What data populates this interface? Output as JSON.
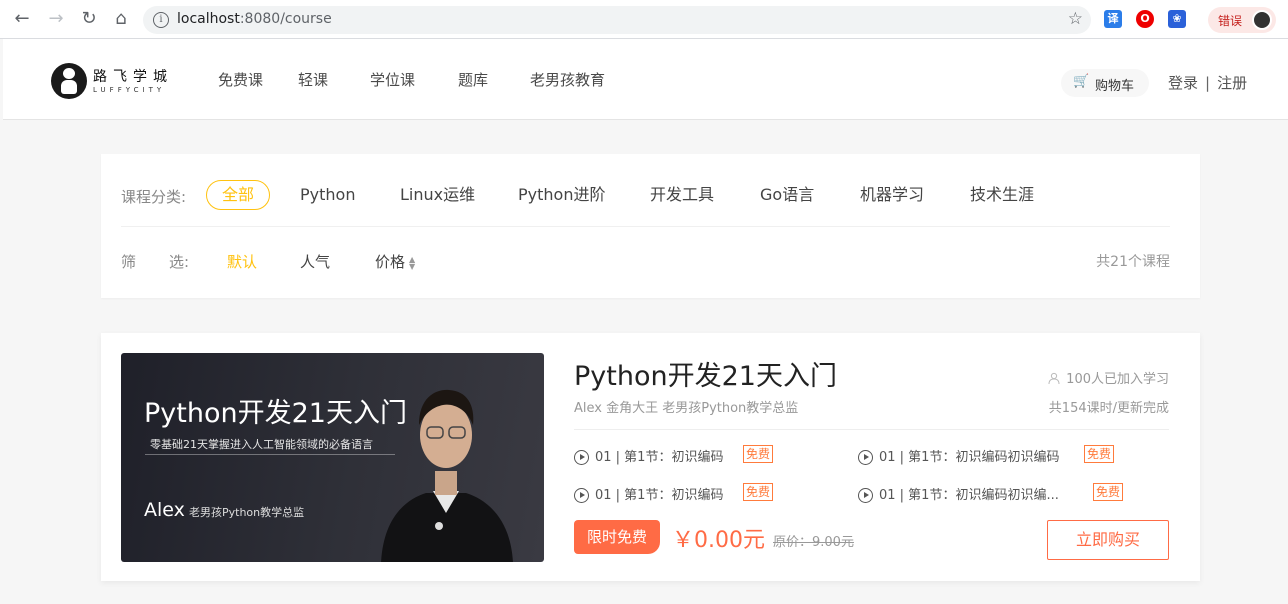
{
  "browser": {
    "url_host": "localhost",
    "url_path": ":8080/course",
    "profile_label": "错误",
    "ext_translate": "译",
    "ext_opera": "O"
  },
  "header": {
    "logo_cn": "路飞学城",
    "logo_en": "LUFFYCITY",
    "nav": [
      "免费课",
      "轻课",
      "学位课",
      "题库",
      "老男孩教育"
    ],
    "cart_label": "购物车",
    "login": "登录",
    "separator": "|",
    "register": "注册"
  },
  "filter": {
    "category_label": "课程分类:",
    "categories": [
      "全部",
      "Python",
      "Linux运维",
      "Python进阶",
      "开发工具",
      "Go语言",
      "机器学习",
      "技术生涯"
    ],
    "active_category": "全部",
    "sort_label_1": "筛",
    "sort_label_2": "选:",
    "sorts": [
      "默认",
      "人气",
      "价格"
    ],
    "active_sort": "默认",
    "total": "共21个课程"
  },
  "course": {
    "cover_title": "Python开发21天入门",
    "cover_subtitle": "零基础21天掌握进入人工智能领域的必备语言",
    "cover_teacher": "Alex",
    "cover_teacher_title": "老男孩Python教学总监",
    "title": "Python开发21天入门",
    "teacher": "Alex 金角大王 老男孩Python教学总监",
    "students": "100人已加入学习",
    "lessons_info": "共154课时/更新完成",
    "lessons": [
      {
        "text": "01 | 第1节：初识编码",
        "badge": "免费"
      },
      {
        "text": "01 | 第1节：初识编码初识编码",
        "badge": "免费"
      },
      {
        "text": "01 | 第1节：初识编码",
        "badge": "免费"
      },
      {
        "text": "01 | 第1节：初识编码初识编...",
        "badge": "免费"
      }
    ],
    "limit_tag": "限时免费",
    "price": "￥0.00元",
    "original_price": "原价：9.00元",
    "buy_label": "立即购买"
  },
  "colors": {
    "accent_yellow": "#ffc210",
    "accent_orange": "#ff6b45"
  }
}
